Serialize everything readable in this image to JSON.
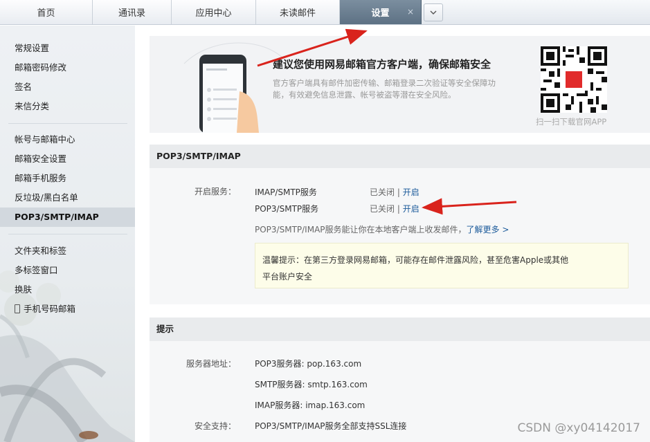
{
  "tabs": [
    {
      "label": "首页"
    },
    {
      "label": "通讯录"
    },
    {
      "label": "应用中心"
    },
    {
      "label": "未读邮件"
    },
    {
      "label": "设置",
      "active": true
    }
  ],
  "tab_close": "×",
  "sidebar": {
    "group1": [
      "常规设置",
      "邮箱密码修改",
      "签名",
      "来信分类"
    ],
    "group2": [
      "帐号与邮箱中心",
      "邮箱安全设置",
      "邮箱手机服务",
      "反垃圾/黑白名单",
      "POP3/SMTP/IMAP"
    ],
    "group3": [
      "文件夹和标签",
      "多标签窗口",
      "换肤"
    ],
    "phone_mail": "手机号码邮箱"
  },
  "banner": {
    "title": "建议您使用网易邮箱官方客户端，确保邮箱安全",
    "desc": "官方客户端具有邮件加密传输、邮箱登录二次验证等安全保障功能，有效避免信息泄露、帐号被盗等潜在安全风险。",
    "qr_caption": "扫一扫下载官网APP"
  },
  "pop3": {
    "heading": "POP3/SMTP/IMAP",
    "service_label": "开启服务：",
    "services": [
      {
        "name": "IMAP/SMTP服务",
        "status": "已关闭",
        "sep": " | ",
        "action": "开启"
      },
      {
        "name": "POP3/SMTP服务",
        "status": "已关闭",
        "sep": " | ",
        "action": "开启"
      }
    ],
    "note": "POP3/SMTP/IMAP服务能让你在本地客户端上收发邮件，",
    "learn_more": "了解更多 >",
    "tip_line1": "温馨提示：在第三方登录网易邮箱，可能存在邮件泄露风险，甚至危害Apple或其他",
    "tip_line2": "平台账户安全"
  },
  "hints": {
    "heading": "提示",
    "server_label": "服务器地址：",
    "servers": [
      "POP3服务器: pop.163.com",
      "SMTP服务器: smtp.163.com",
      "IMAP服务器: imap.163.com"
    ],
    "security_label": "安全支持：",
    "security": "POP3/SMTP/IMAP服务全部支持SSL连接"
  },
  "watermark": "CSDN @xy04142017",
  "colors": {
    "active_tab": "#6a7e91",
    "link": "#1b5a9a",
    "arrow": "#d9231c",
    "tip_bg": "#fdfde9"
  }
}
